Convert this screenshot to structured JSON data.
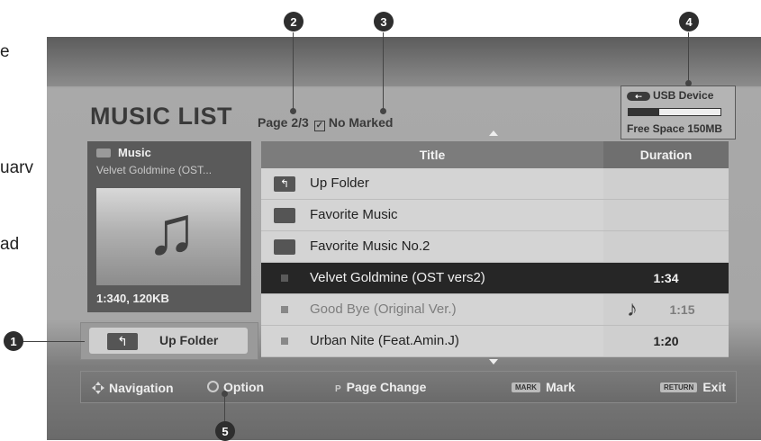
{
  "side_fragments": [
    "e",
    "uarv",
    "ad"
  ],
  "callouts": [
    "1",
    "2",
    "3",
    "4",
    "5"
  ],
  "header": {
    "title": "MUSIC LIST",
    "page": "Page 2/3",
    "marked": "No Marked",
    "checkbox_glyph": "✓"
  },
  "usb": {
    "label": "USB Device",
    "icon": "usb-icon",
    "free_space": "Free Space 150MB",
    "usage_fraction": 0.33
  },
  "preview": {
    "folder_label": "Music",
    "track": "Velvet Goldmine (OST...",
    "info": "1:340, 120KB",
    "note_glyph": "♫"
  },
  "up_folder_button": "Up Folder",
  "table": {
    "col_title": "Title",
    "col_duration": "Duration",
    "rows": [
      {
        "title": "Up Folder",
        "duration": "",
        "kind": "up-folder"
      },
      {
        "title": "Favorite Music",
        "duration": "",
        "kind": "folder"
      },
      {
        "title": "Favorite Music No.2",
        "duration": "",
        "kind": "folder"
      },
      {
        "title": "Velvet Goldmine (OST vers2)",
        "duration": "1:34",
        "kind": "track",
        "selected": true
      },
      {
        "title": "Good Bye (Original Ver.)",
        "duration": "1:15",
        "kind": "track",
        "playing": true
      },
      {
        "title": "Urban Nite (Feat.Amin.J)",
        "duration": "1:20",
        "kind": "track"
      }
    ]
  },
  "bottom_bar": {
    "navigation": "Navigation",
    "option": "Option",
    "page_key": "P",
    "page_change": "Page Change",
    "mark_key": "MARK",
    "mark": "Mark",
    "return_key": "RETURN",
    "exit": "Exit"
  }
}
